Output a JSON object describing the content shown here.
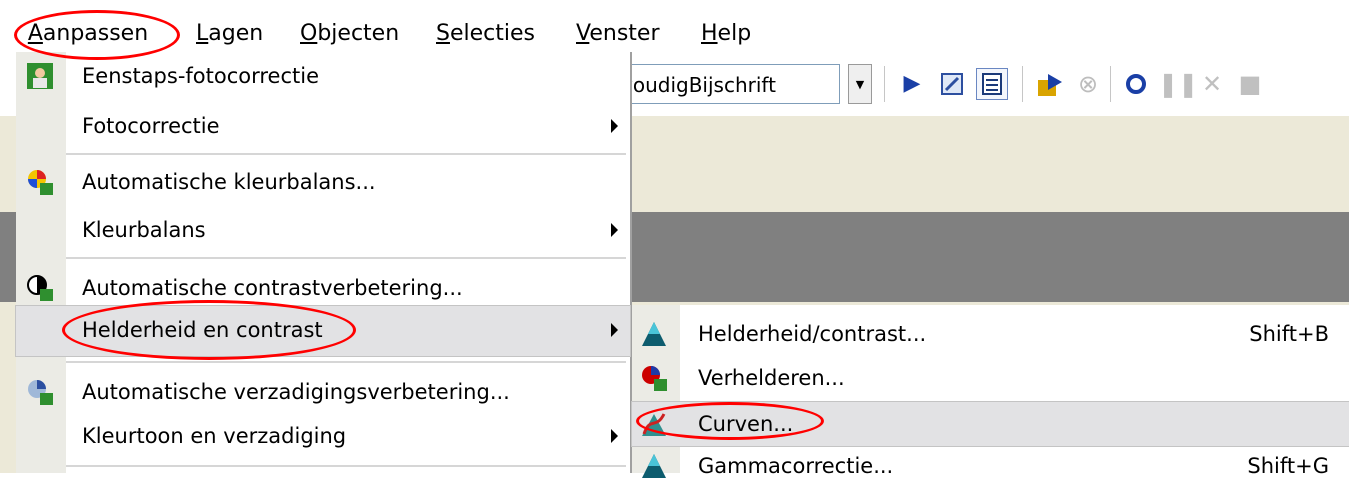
{
  "menubar": {
    "items": [
      "Aanpassen",
      "Lagen",
      "Objecten",
      "Selecties",
      "Venster",
      "Help"
    ],
    "mnemonics": [
      "A",
      "L",
      "O",
      "S",
      "V",
      "H"
    ]
  },
  "toolbar": {
    "style_combo_value": "voudigBijschrift",
    "icons": [
      "play-icon",
      "script-edit-icon",
      "form-icon",
      "run-script-icon",
      "stop-circle-icon",
      "record-icon",
      "pause-icon",
      "cancel-icon",
      "stop-icon"
    ]
  },
  "menu": {
    "items": [
      {
        "label": "Eenstaps-fotocorrectie",
        "icon": "photo-fix-icon",
        "submenu": false
      },
      {
        "label": "Fotocorrectie",
        "icon": "",
        "submenu": true
      },
      {
        "label": "Automatische kleurbalans...",
        "icon": "color-balance-icon",
        "submenu": false
      },
      {
        "label": "Kleurbalans",
        "icon": "",
        "submenu": true
      },
      {
        "label": "Automatische contrastverbetering...",
        "icon": "contrast-icon",
        "submenu": false
      },
      {
        "label": "Helderheid en contrast",
        "icon": "",
        "submenu": true,
        "highlighted": true
      },
      {
        "label": "Automatische verzadigingsverbetering...",
        "icon": "saturation-icon",
        "submenu": false
      },
      {
        "label": "Kleurtoon en verzadiging",
        "icon": "",
        "submenu": true
      }
    ]
  },
  "submenu": {
    "items": [
      {
        "label": "Helderheid/contrast...",
        "shortcut": "Shift+B",
        "icon": "brightness-contrast-icon"
      },
      {
        "label": "Verhelderen...",
        "shortcut": "",
        "icon": "clarify-icon"
      },
      {
        "label": "Curven...",
        "shortcut": "",
        "icon": "curves-icon",
        "highlighted": true
      },
      {
        "label": "Gammacorrectie...",
        "shortcut": "Shift+G",
        "icon": "gamma-icon"
      }
    ]
  },
  "colors": {
    "annotation": "#ff0000",
    "highlight": "#e2e2e4",
    "gutter": "#ebebe5",
    "canvas": "#808080",
    "toolbar_icon_blue": "#1a3fa6"
  }
}
